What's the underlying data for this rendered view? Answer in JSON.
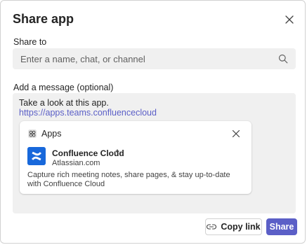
{
  "dialog": {
    "title": "Share app",
    "share_to_label": "Share to",
    "search_placeholder": "Enter a name, chat, or channel",
    "message_label": "Add a message (optional)",
    "message": {
      "line1": "Take a look at this app.",
      "link": "https://apps.teams.confluencecloud"
    },
    "card": {
      "section_label": "Apps",
      "app_name": "Confluence Cloud",
      "publisher": "Atlassian.com",
      "description": "Capture rich meeting notes, share pages, & stay up-to-date with Confluence Cloud"
    },
    "buttons": {
      "copy_link": "Copy link",
      "share": "Share"
    }
  },
  "colors": {
    "accent": "#5b5fc7",
    "app_logo": "#1868db",
    "field_bg": "#f0f0f0"
  },
  "icons": {
    "close": "close-icon",
    "search": "search-icon",
    "apps": "apps-icon",
    "card_close": "close-icon",
    "verified": "verified-icon",
    "link": "link-icon"
  }
}
